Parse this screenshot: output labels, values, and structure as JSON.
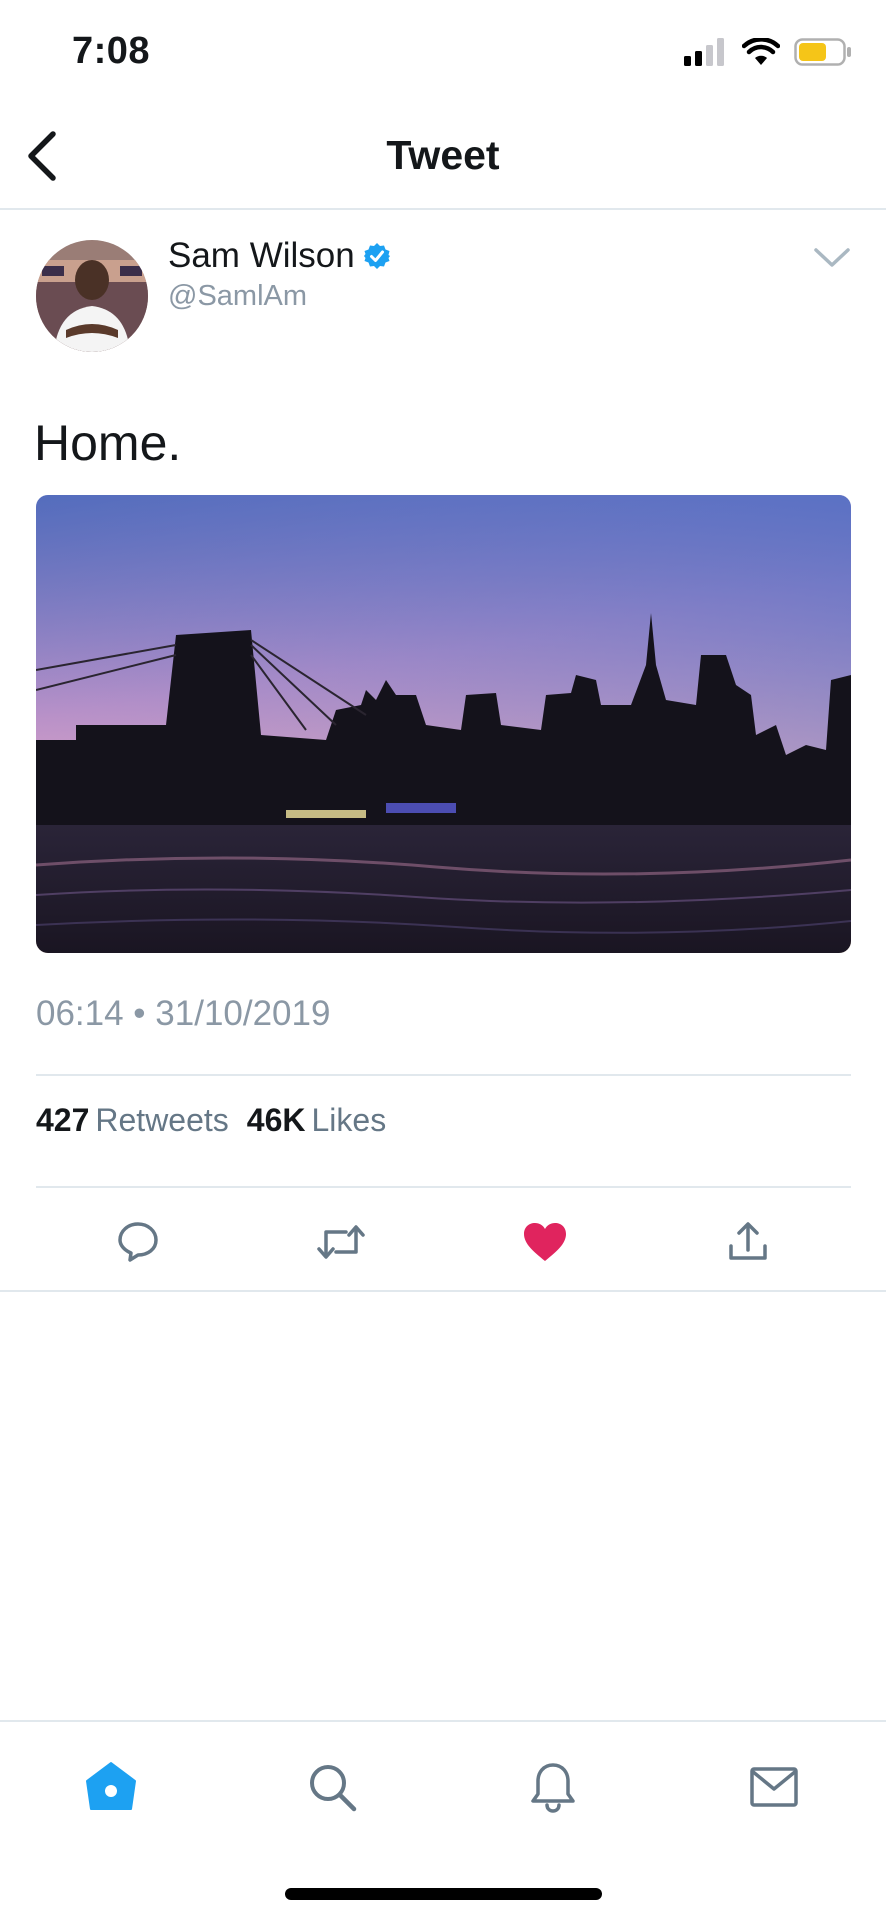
{
  "status_bar": {
    "time": "7:08",
    "battery_color": "#f5c518"
  },
  "header": {
    "title": "Tweet",
    "back_icon": "chevron-left-icon"
  },
  "tweet": {
    "author": {
      "display_name": "Sam Wilson",
      "handle": "@SamlAm",
      "verified": true,
      "verified_color": "#1da1f2"
    },
    "text": "Home.",
    "media_description_icon": "city-skyline-photo",
    "timestamp": "06:14 • 31/10/2019",
    "stats": {
      "retweets_count": "427",
      "retweets_label": "Retweets",
      "likes_count": "46K",
      "likes_label": "Likes"
    },
    "liked": true,
    "like_color": "#e0245e"
  },
  "actions": [
    "reply-icon",
    "retweet-icon",
    "like-icon",
    "share-icon"
  ],
  "tabbar": {
    "active": "home",
    "accent_color": "#1da1f2",
    "items": [
      "home-icon",
      "search-icon",
      "bell-icon",
      "mail-icon"
    ]
  }
}
